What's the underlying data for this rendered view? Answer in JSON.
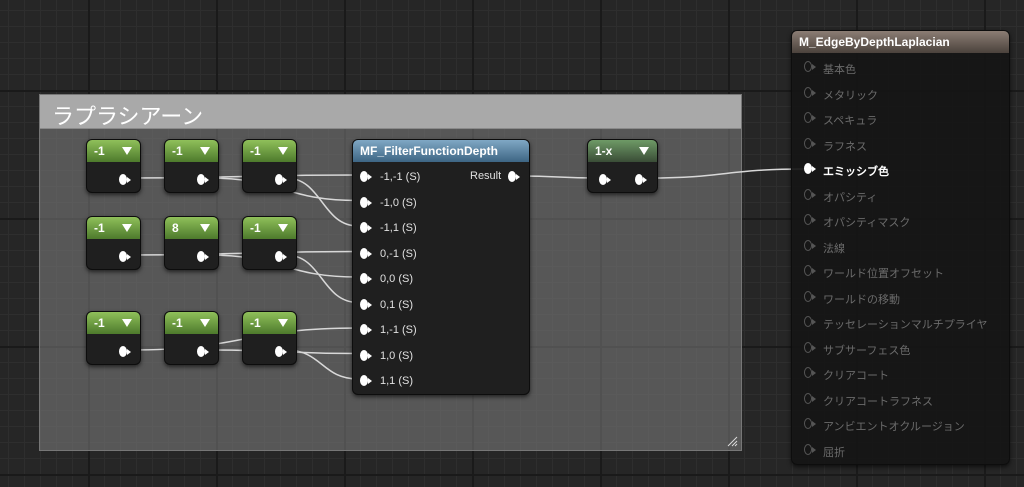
{
  "comment": {
    "title": "ラプラシアーン"
  },
  "constants": [
    {
      "label": "-1",
      "style": "green"
    },
    {
      "label": "-1",
      "style": "green"
    },
    {
      "label": "-1",
      "style": "green"
    },
    {
      "label": "-1",
      "style": "green"
    },
    {
      "label": "8",
      "style": "green"
    },
    {
      "label": "-1",
      "style": "green"
    },
    {
      "label": "-1",
      "style": "green"
    },
    {
      "label": "-1",
      "style": "green"
    },
    {
      "label": "-1",
      "style": "green"
    }
  ],
  "function_node": {
    "title": "MF_FilterFunctionDepth",
    "inputs": [
      "-1,-1 (S)",
      "-1,0 (S)",
      "-1,1 (S)",
      "0,-1 (S)",
      "0,0 (S)",
      "0,1 (S)",
      "1,-1 (S)",
      "1,0 (S)",
      "1,1 (S)"
    ],
    "output": "Result"
  },
  "one_minus": {
    "title": "1-x"
  },
  "material": {
    "title": "M_EdgeByDepthLaplacian",
    "inputs": [
      {
        "label": "基本色",
        "active": false
      },
      {
        "label": "メタリック",
        "active": false
      },
      {
        "label": "スペキュラ",
        "active": false
      },
      {
        "label": "ラフネス",
        "active": false
      },
      {
        "label": "エミッシブ色",
        "active": true
      },
      {
        "label": "オパシティ",
        "active": false
      },
      {
        "label": "オパシティマスク",
        "active": false
      },
      {
        "label": "法線",
        "active": false
      },
      {
        "label": "ワールド位置オフセット",
        "active": false
      },
      {
        "label": "ワールドの移動",
        "active": false
      },
      {
        "label": "テッセレーションマルチプライヤ",
        "active": false
      },
      {
        "label": "サブサーフェス色",
        "active": false
      },
      {
        "label": "クリアコート",
        "active": false
      },
      {
        "label": "クリアコートラフネス",
        "active": false
      },
      {
        "label": "アンビエントオクルージョン",
        "active": false
      },
      {
        "label": "屈折",
        "active": false
      }
    ]
  },
  "colors": {
    "wire": "#d8d8d8",
    "constant_header": "#6a9a3f",
    "function_header": "#5a86a8"
  }
}
